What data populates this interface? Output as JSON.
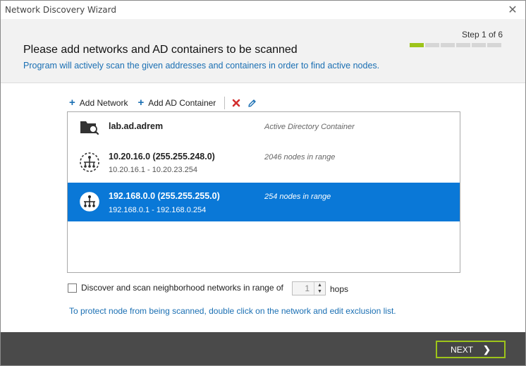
{
  "window": {
    "title": "Network Discovery Wizard",
    "close_glyph": "✕"
  },
  "header": {
    "heading": "Please add networks and AD containers to be scanned",
    "subheading": "Program will actively scan the given addresses and containers in order to find active nodes.",
    "step_label": "Step 1 of 6",
    "step_current": 1,
    "step_total": 6,
    "accent_color": "#9dc41a",
    "link_color": "#1a6fb3"
  },
  "toolbar": {
    "add_network_label": "Add Network",
    "add_ad_container_label": "Add AD Container",
    "delete_icon": "delete-x-icon",
    "edit_icon": "pencil-icon"
  },
  "list": {
    "items": [
      {
        "name": "lab.ad.adrem",
        "range": "",
        "info": "Active Directory Container",
        "icon": "ad-container-icon",
        "selected": false
      },
      {
        "name": "10.20.16.0  (255.255.248.0)",
        "range": "10.20.16.1 - 10.20.23.254",
        "info": "2046 nodes in range",
        "icon": "network-icon",
        "selected": false
      },
      {
        "name": "192.168.0.0  (255.255.255.0)",
        "range": "192.168.0.1 - 192.168.0.254",
        "info": "254 nodes in range",
        "icon": "network-icon",
        "selected": true
      }
    ],
    "selected_color": "#0a78d7"
  },
  "options": {
    "neighborhood_label": "Discover and scan neighborhood networks in range of",
    "neighborhood_checked": false,
    "hops_value": "1",
    "hops_label": "hops",
    "hint": "To protect node from being scanned, double click on the network and edit exclusion list."
  },
  "footer": {
    "next_label": "NEXT",
    "next_glyph": "❯"
  }
}
